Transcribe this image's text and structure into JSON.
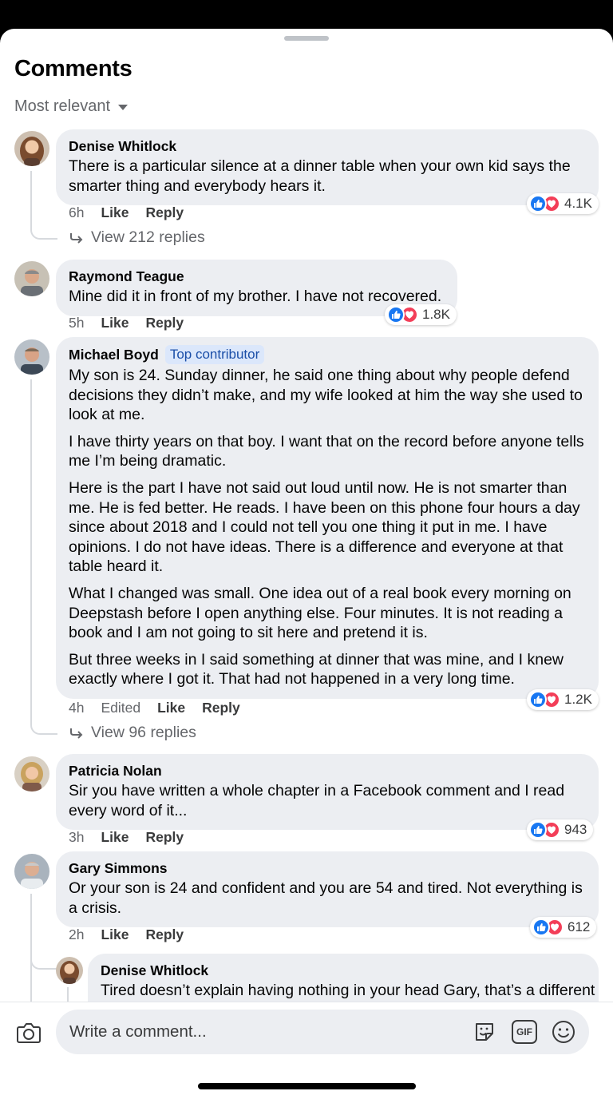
{
  "header": {
    "title": "Comments",
    "sort_label": "Most relevant"
  },
  "comments": [
    {
      "author": "Denise Whitlock",
      "text": "There is a particular silence at a dinner table when your own kid says the smarter thing and everybody hears it.",
      "time": "6h",
      "like": "Like",
      "reply": "Reply",
      "reactions": "4.1K",
      "view_replies": "View 212 replies"
    },
    {
      "author": "Raymond Teague",
      "text": "Mine did it in front of my brother. I have not recovered.",
      "time": "5h",
      "like": "Like",
      "reply": "Reply",
      "reactions": "1.8K"
    },
    {
      "author": "Michael Boyd",
      "badge": "Top contributor",
      "paragraphs": [
        "My son is 24. Sunday dinner, he said one thing about why people defend decisions they didn’t make, and my wife looked at him the way she used to look at me.",
        "I have thirty years on that boy. I want that on the record before anyone tells me I’m being dramatic.",
        "Here is the part I have not said out loud until now. He is not smarter than me. He is fed better. He reads. I have been on this phone four hours a day since about 2018 and I could not tell you one thing it put in me. I have opinions. I do not have ideas. There is a difference and everyone at that table heard it.",
        "What I changed was small. One idea out of a real book every morning on Deepstash before I open anything else. Four minutes. It is not reading a book and I am not going to sit here and pretend it is.",
        "But three weeks in I said something at dinner that was mine, and I knew exactly where I got it. That had not happened in a very long time."
      ],
      "time": "4h",
      "edited": "Edited",
      "like": "Like",
      "reply": "Reply",
      "reactions": "1.2K",
      "view_replies": "View 96 replies"
    },
    {
      "author": "Patricia Nolan",
      "text": "Sir you have written a whole chapter in a Facebook comment and I read every word of it...",
      "time": "3h",
      "like": "Like",
      "reply": "Reply",
      "reactions": "943"
    },
    {
      "author": "Gary Simmons",
      "text": "Or your son is 24 and confident and you are 54 and tired. Not everything is a crisis.",
      "time": "2h",
      "like": "Like",
      "reply": "Reply",
      "reactions": "612"
    }
  ],
  "reply": {
    "author": "Denise Whitlock",
    "text": "Tired doesn’t explain having nothing in your head Gary, that’s a different"
  },
  "composer": {
    "placeholder": "Write a comment...",
    "gif_label": "GIF"
  },
  "colors": {
    "like": "#1877f2",
    "love": "#f33e58",
    "bubble": "#eceef2",
    "badge_bg": "#dbe7fb"
  }
}
